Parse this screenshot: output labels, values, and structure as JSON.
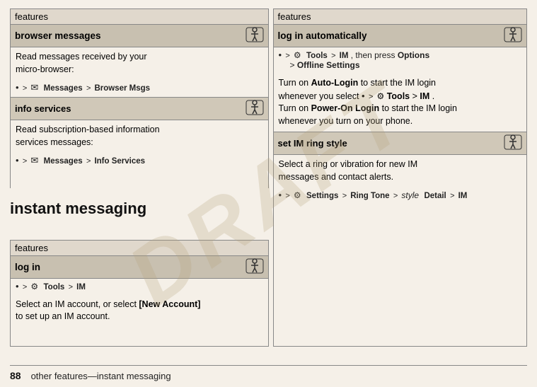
{
  "page": {
    "number": "88",
    "footer_text": "other features—instant messaging",
    "draft_watermark": "DRAFT"
  },
  "left_top_table": {
    "header": "features",
    "sections": [
      {
        "title": "browser messages",
        "content_lines": [
          "Read messages received by your",
          "micro-browser:"
        ],
        "nav_path": "· > ✉ Messages > Browser Msgs"
      },
      {
        "title": "info services",
        "content_lines": [
          "Read subscription-based information",
          "services messages:"
        ],
        "nav_path": "· > ✉ Messages > Info Services"
      }
    ]
  },
  "instant_messaging_heading": "instant messaging",
  "left_bottom_table": {
    "header": "features",
    "sections": [
      {
        "title": "log in",
        "nav_path_1": "· > ⚙ Tools > IM",
        "content_line": "Select an IM account, or select [New Account]",
        "content_line2": "to set up an IM account."
      }
    ]
  },
  "right_table": {
    "header": "features",
    "sections": [
      {
        "title": "log in automatically",
        "nav_path": "· > ⚙ Tools > IM, then press Options > Offline Settings",
        "content_lines_1": "Turn on Auto-Login to start the IM login",
        "content_lines_2": "whenever you select · > ⚙ Tools > IM.",
        "content_lines_3": "Turn on Power-On Login to start the IM login",
        "content_lines_4": "whenever you turn on your phone."
      },
      {
        "title": "set IM ring style",
        "content_line1": "Select a ring or vibration for new IM",
        "content_line2": "messages and contact alerts.",
        "nav_path": "· > ⚙ Settings > Ring Tone > style Detail > IM"
      }
    ]
  },
  "icons": {
    "accessibility": "♿",
    "message": "✉",
    "tools": "⚙",
    "settings": "⚙",
    "bullet": "•",
    "arrow": ">",
    "new_account": "[New Account]",
    "auto_login": "Auto-Login",
    "power_on_login": "Power-On Login",
    "options": "Options",
    "offline_settings": "Offline Settings",
    "ring_tone": "Ring Tone",
    "detail": "Detail"
  }
}
